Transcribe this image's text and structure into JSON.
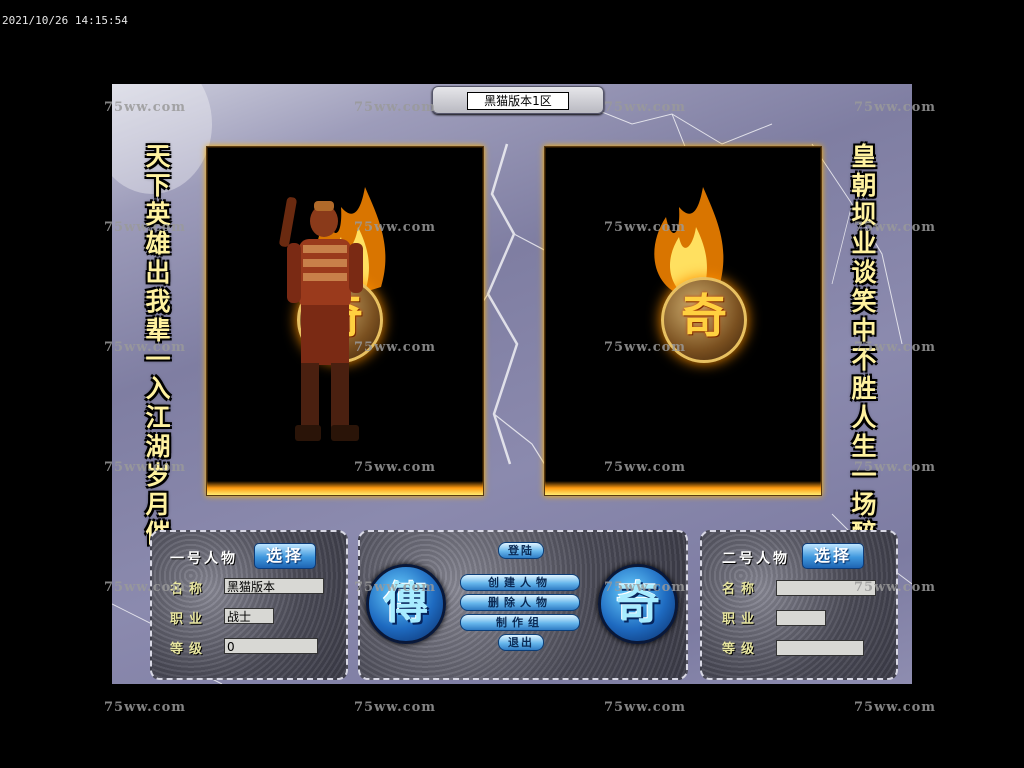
{
  "timestamp": "2021/10/26 14:15:54",
  "watermark": "75ww.com",
  "server": {
    "name": "黑猫版本1区"
  },
  "slogans": {
    "left": "天下英雄出我辈 一入江湖岁月催",
    "right": "皇朝坝业谈笑中 不胜人生一场醉"
  },
  "slot1": {
    "emblem": "奇",
    "character": "warrior-figure"
  },
  "slot2": {
    "emblem": "奇"
  },
  "player1": {
    "title": "一号人物",
    "select": "选择",
    "name_label": "名称",
    "job_label": "职业",
    "level_label": "等级",
    "name": "黑猫版本",
    "job": "战士",
    "level": "0"
  },
  "player2": {
    "title": "二号人物",
    "select": "选择",
    "name_label": "名称",
    "job_label": "职业",
    "level_label": "等级",
    "name": "",
    "job": "",
    "level": ""
  },
  "center": {
    "start": "登陆",
    "create": "创建人物",
    "delete": "删除人物",
    "credits": "制作组",
    "exit": "退出",
    "orb_left": "傳",
    "orb_right": "奇"
  },
  "colors": {
    "flame": "#ffb400",
    "button_blue": "#3f98de",
    "slogan": "#fff2a0"
  }
}
